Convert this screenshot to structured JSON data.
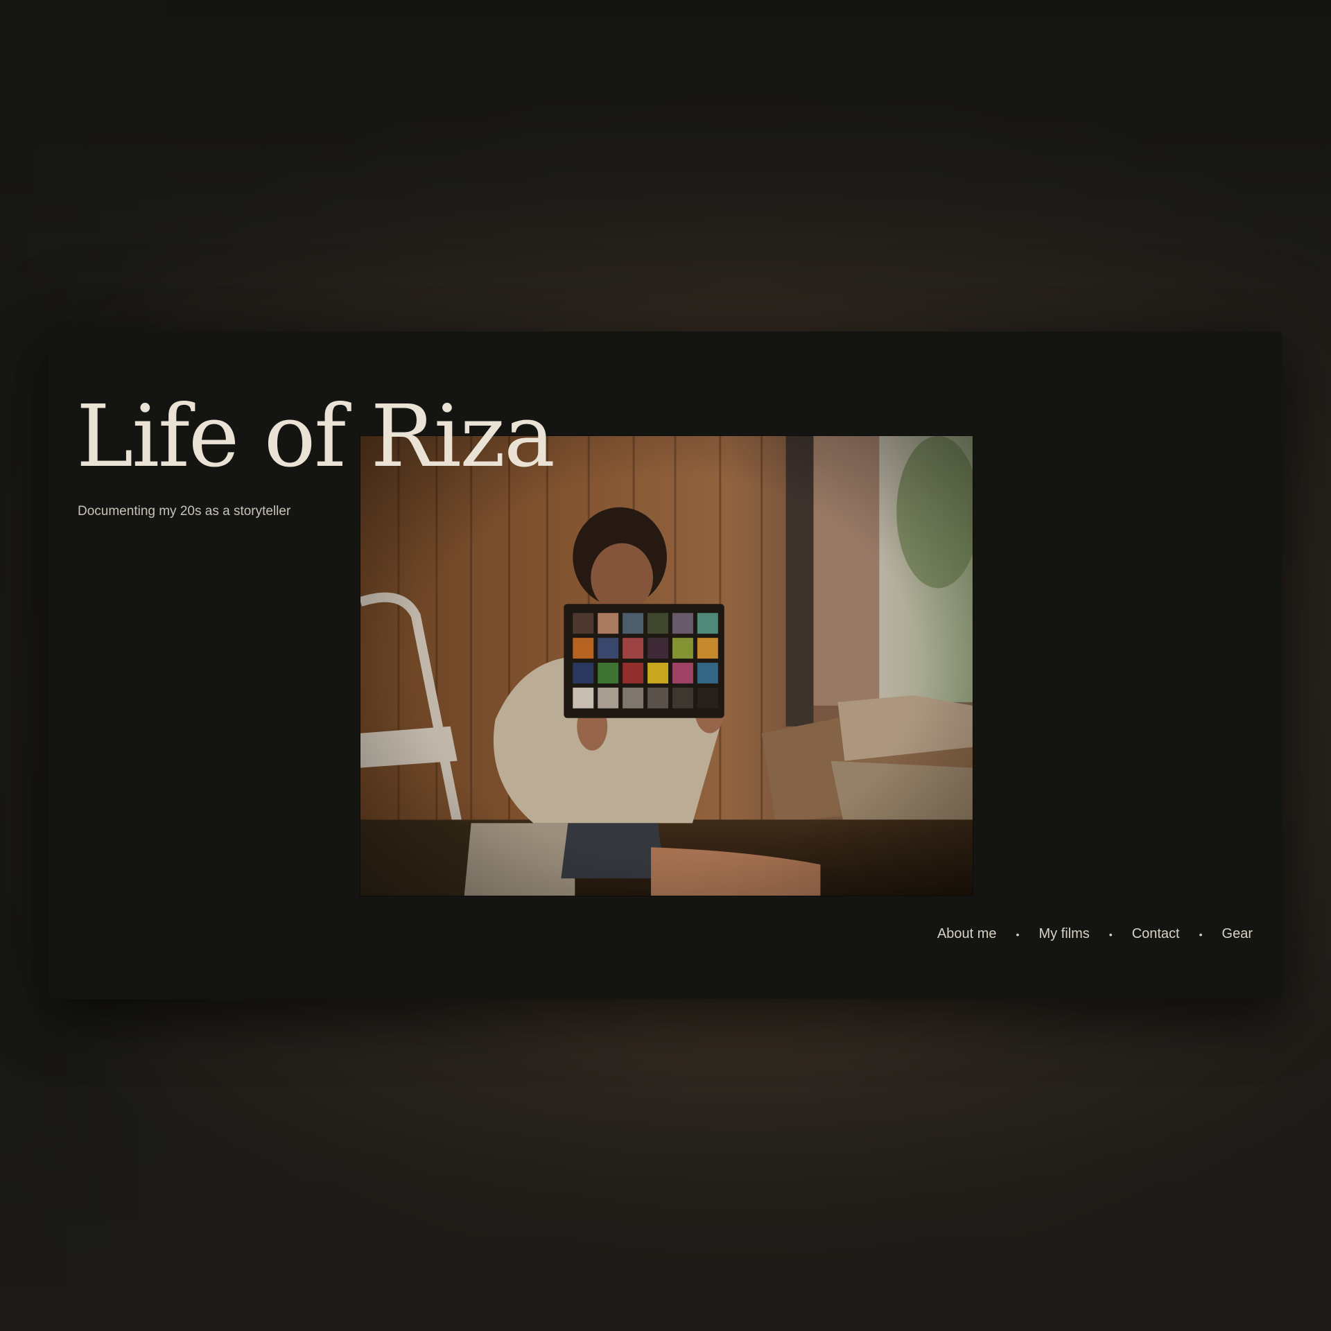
{
  "site": {
    "title": "Life of Riza",
    "subtitle": "Documenting my 20s as a storyteller"
  },
  "hero_image": {
    "subject": "photo of a woman holding a color checker chart in a wood-paneled room with moving boxes"
  },
  "nav": {
    "items": [
      {
        "label": "About me"
      },
      {
        "label": "My films"
      },
      {
        "label": "Contact"
      },
      {
        "label": "Gear"
      }
    ],
    "separator": "•"
  },
  "colors": {
    "card_background": "#141512",
    "title": "#e9e2d5",
    "text": "#d8d2c6",
    "ambient_glow": "#6e553a"
  }
}
